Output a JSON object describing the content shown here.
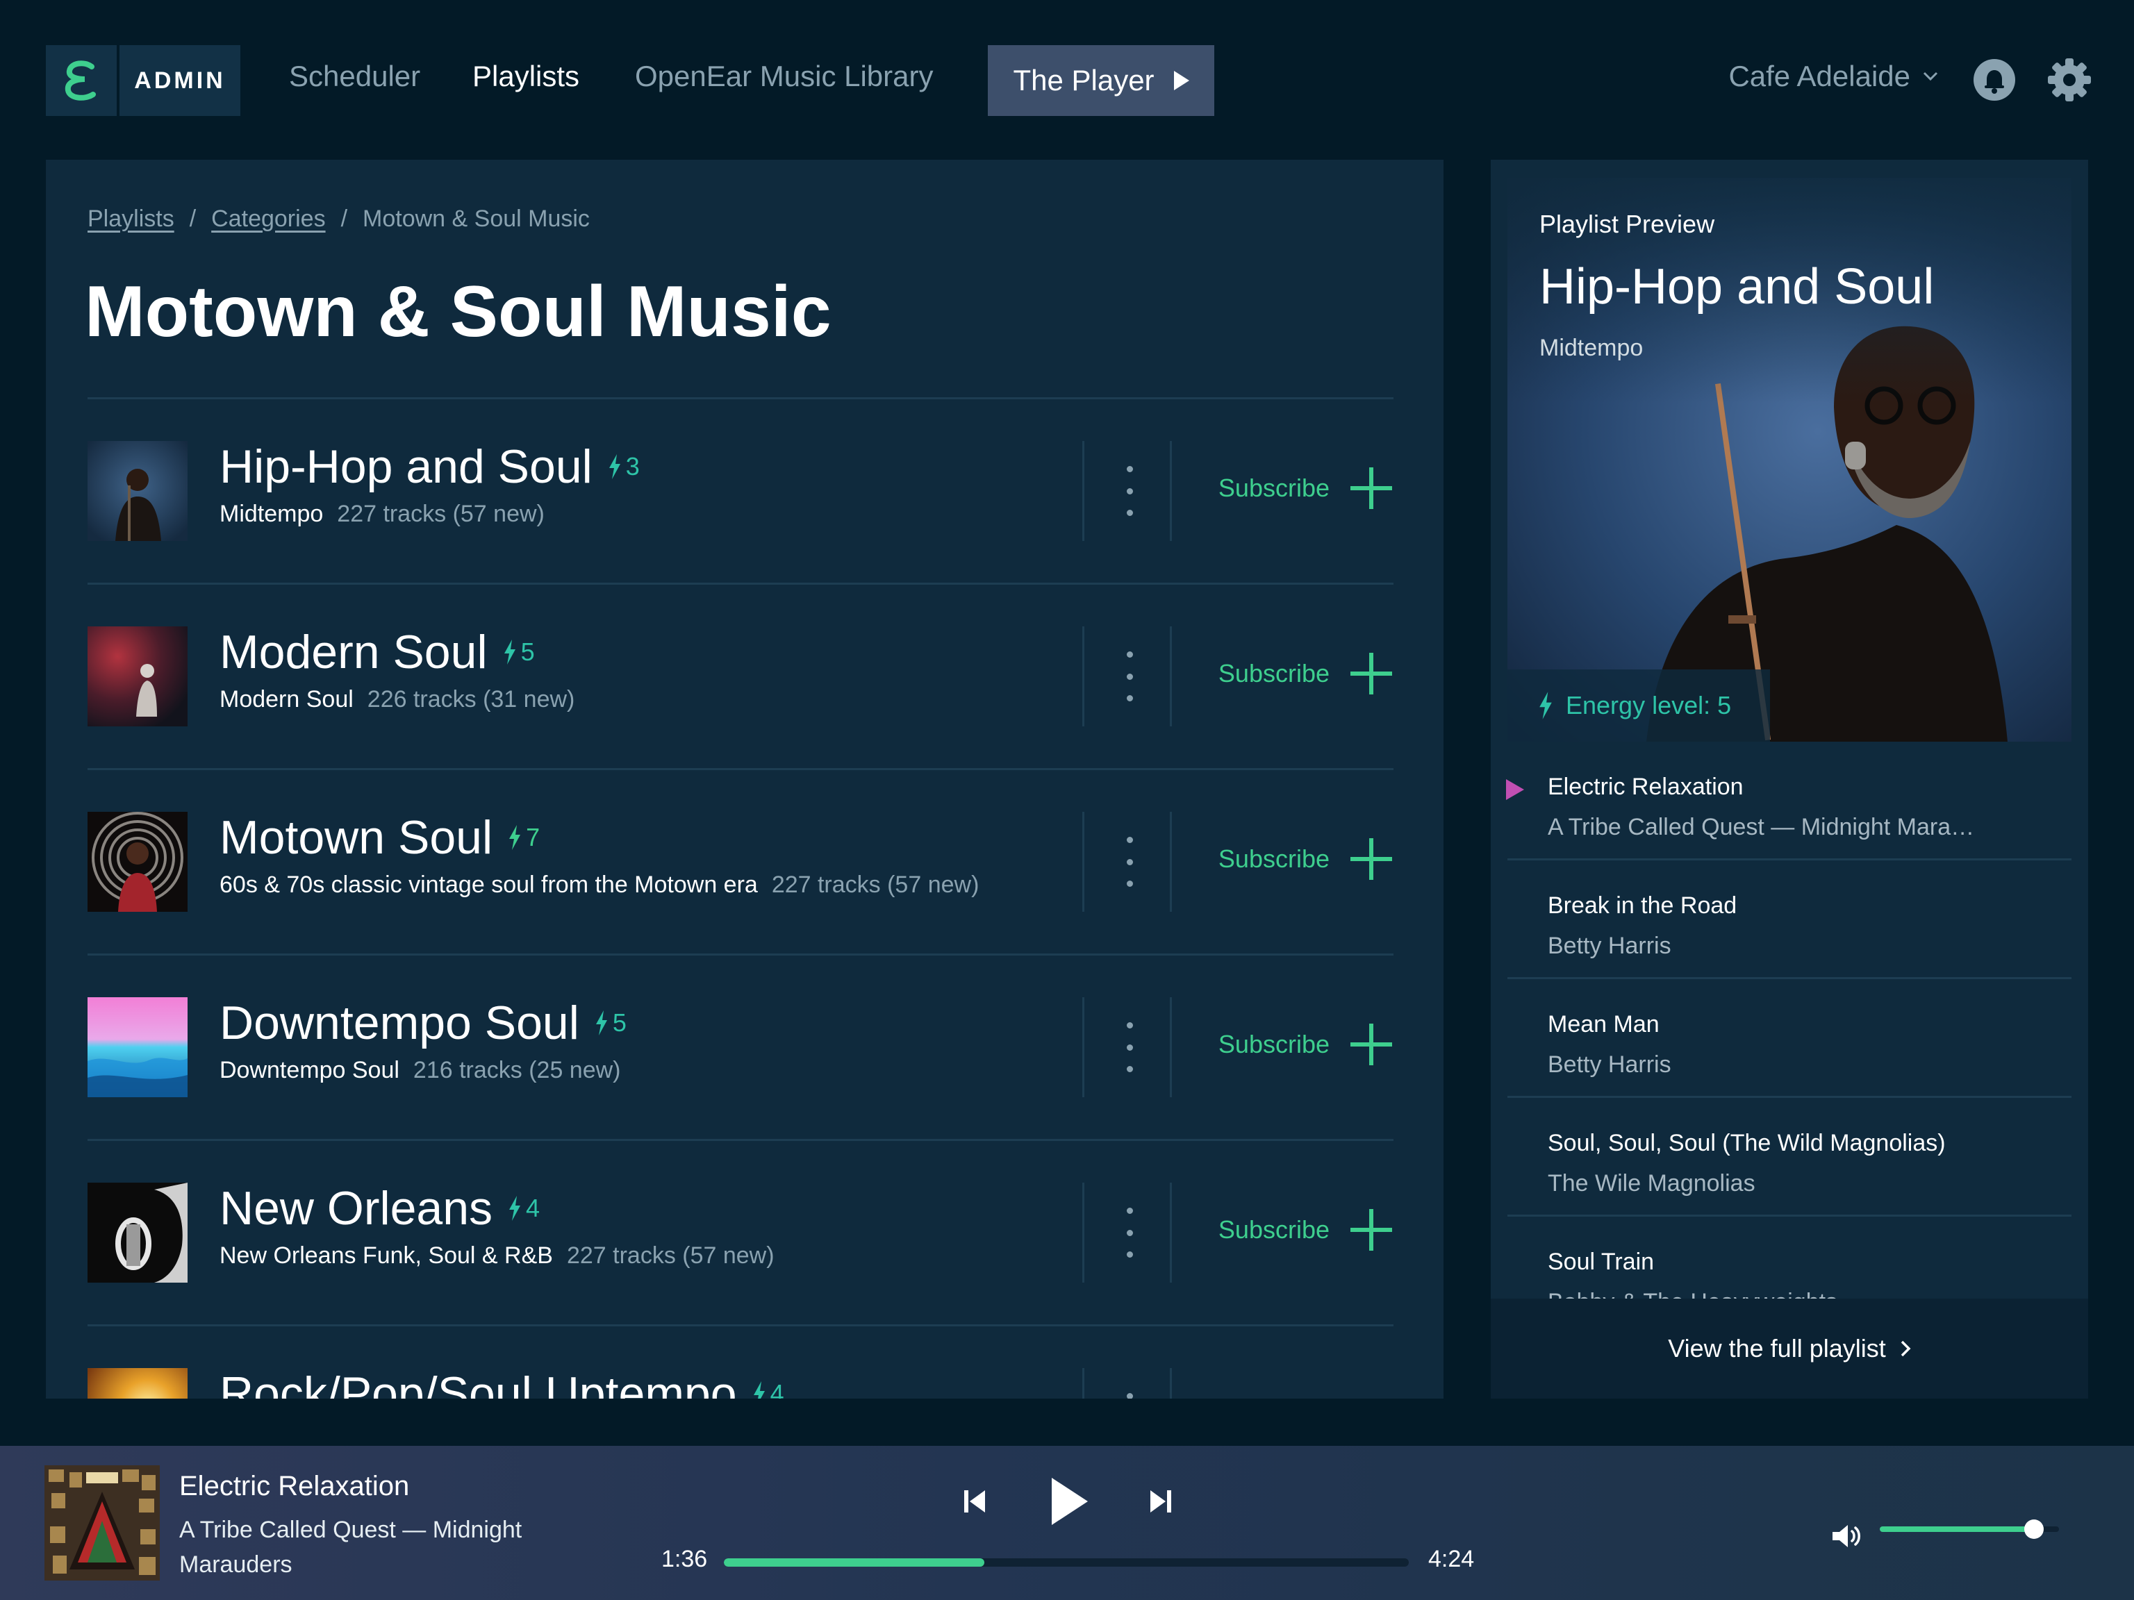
{
  "nav": {
    "admin_label": "ADMIN",
    "links": [
      "Scheduler",
      "Playlists",
      "OpenEar Music Library"
    ],
    "player_button": "The Player",
    "venue": "Cafe Adelaide"
  },
  "breadcrumb": [
    "Playlists",
    "Categories",
    "Motown & Soul Music"
  ],
  "page_title": "Motown & Soul Music",
  "subscribe_label": "Subscribe",
  "playlists": [
    {
      "title": "Hip-Hop and Soul",
      "energy": "3",
      "subtitle": "Midtempo",
      "tracks": "227 tracks (57 new)"
    },
    {
      "title": "Modern Soul",
      "energy": "5",
      "subtitle": "Modern Soul",
      "tracks": "226 tracks (31 new)"
    },
    {
      "title": "Motown Soul",
      "energy": "7",
      "subtitle": "60s & 70s classic vintage soul from the Motown era",
      "tracks": "227 tracks (57 new)"
    },
    {
      "title": "Downtempo Soul",
      "energy": "5",
      "subtitle": "Downtempo Soul",
      "tracks": "216 tracks (25 new)"
    },
    {
      "title": "New Orleans",
      "energy": "4",
      "subtitle": "New Orleans Funk, Soul & R&B",
      "tracks": "227 tracks (57 new)"
    },
    {
      "title": "Rock/Pop/Soul Uptempo",
      "energy": "4",
      "subtitle": "",
      "tracks": ""
    }
  ],
  "preview": {
    "label": "Playlist Preview",
    "title": "Hip-Hop and Soul",
    "subtitle": "Midtempo",
    "energy_label": "Energy level: 5",
    "tracks": [
      {
        "title": "Electric Relaxation",
        "artist": "A Tribe Called Quest — Midnight Marauders",
        "playing": true
      },
      {
        "title": "Break in the Road",
        "artist": "Betty Harris",
        "playing": false
      },
      {
        "title": "Mean Man",
        "artist": "Betty Harris",
        "playing": false
      },
      {
        "title": "Soul, Soul, Soul (The Wild Magnolias)",
        "artist": "The Wile Magnolias",
        "playing": false
      },
      {
        "title": "Soul Train",
        "artist": "Bobby & The Heavyweights",
        "playing": false
      }
    ],
    "full_link": "View the full playlist"
  },
  "now_playing": {
    "title": "Electric Relaxation",
    "artist": "A Tribe Called Quest — Midnight Marauders",
    "elapsed": "1:36",
    "duration": "4:24",
    "progress": 0.38,
    "volume": 0.86
  },
  "colors": {
    "background": "#031a27",
    "card": "#0f2a3d",
    "accent_green": "#3ecf8e",
    "energy_teal": "#2ec4a8",
    "play_marker": "#c04fb2",
    "muted_text": "#8aa2b0"
  },
  "icons": {
    "logo": "openear-logo",
    "player_arrow": "play-triangle-icon",
    "venue_dropdown": "chevron-down-icon",
    "notifications": "bell-icon",
    "settings": "gear-icon",
    "energy": "lightning-icon",
    "row_menu": "kebab-icon",
    "subscribe": "plus-icon",
    "previous": "skip-back-icon",
    "play": "play-icon",
    "next": "skip-forward-icon",
    "volume": "speaker-icon"
  }
}
